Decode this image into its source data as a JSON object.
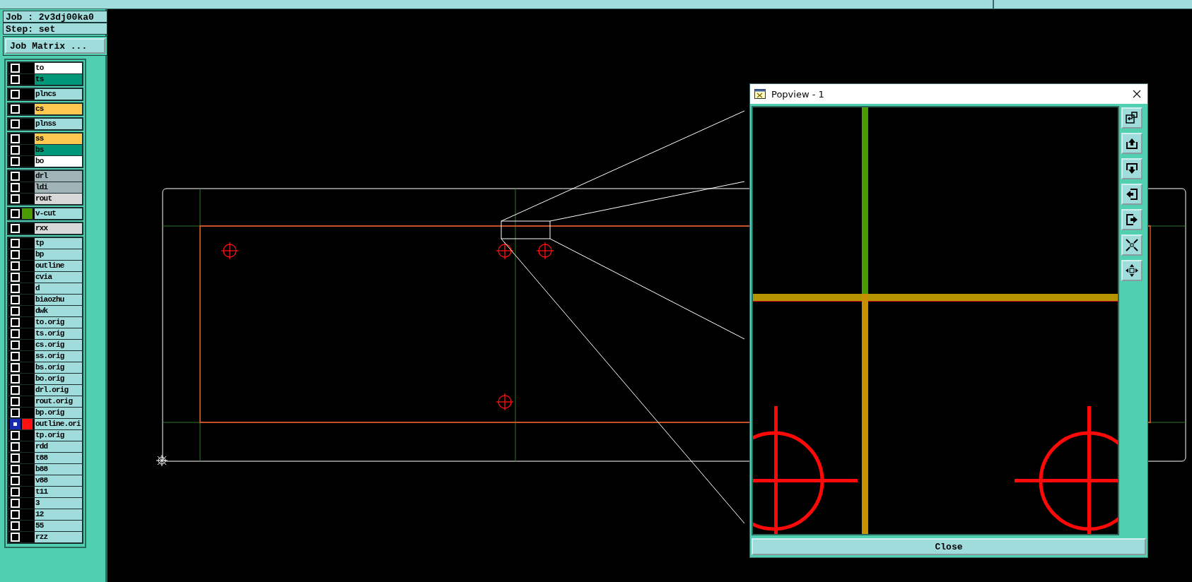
{
  "job_label": "Job : 2v3dj00ka0",
  "step_label": "Step: set",
  "job_matrix_button": "Job Matrix ...",
  "layer_groups": [
    [
      {
        "name": "to",
        "kind": "silk",
        "selected": false
      },
      {
        "name": "ts",
        "kind": "mask",
        "selected": false
      }
    ],
    [
      {
        "name": "plncs",
        "kind": "misc",
        "selected": false
      }
    ],
    [
      {
        "name": "cs",
        "kind": "signal",
        "selected": false
      }
    ],
    [
      {
        "name": "plnss",
        "kind": "misc",
        "selected": false
      }
    ],
    [
      {
        "name": "ss",
        "kind": "signal",
        "selected": false
      },
      {
        "name": "bs",
        "kind": "mask",
        "selected": false
      },
      {
        "name": "bo",
        "kind": "silk",
        "selected": false
      }
    ],
    [
      {
        "name": "drl",
        "kind": "drill",
        "selected": false
      },
      {
        "name": "ldi",
        "kind": "drill",
        "selected": false
      },
      {
        "name": "rout",
        "kind": "rout",
        "selected": false
      }
    ],
    [
      {
        "name": "v-cut",
        "kind": "misc",
        "selected": false,
        "color": "#4a9a00"
      }
    ],
    [
      {
        "name": "rxx",
        "kind": "rout",
        "selected": false
      }
    ],
    [
      {
        "name": "tp",
        "kind": "misc",
        "selected": false
      },
      {
        "name": "bp",
        "kind": "misc",
        "selected": false
      },
      {
        "name": "outline",
        "kind": "misc",
        "selected": false
      },
      {
        "name": "cvia",
        "kind": "misc",
        "selected": false
      },
      {
        "name": "d",
        "kind": "misc",
        "selected": false
      },
      {
        "name": "biaozhu",
        "kind": "misc",
        "selected": false
      },
      {
        "name": "dwk",
        "kind": "misc",
        "selected": false
      },
      {
        "name": "to.orig",
        "kind": "misc",
        "selected": false
      },
      {
        "name": "ts.orig",
        "kind": "misc",
        "selected": false
      },
      {
        "name": "cs.orig",
        "kind": "misc",
        "selected": false
      },
      {
        "name": "ss.orig",
        "kind": "misc",
        "selected": false
      },
      {
        "name": "bs.orig",
        "kind": "misc",
        "selected": false
      },
      {
        "name": "bo.orig",
        "kind": "misc",
        "selected": false
      },
      {
        "name": "drl.orig",
        "kind": "misc",
        "selected": false
      },
      {
        "name": "rout.orig",
        "kind": "misc",
        "selected": false
      },
      {
        "name": "bp.orig",
        "kind": "misc",
        "selected": false
      },
      {
        "name": "outline.ori",
        "kind": "misc",
        "selected": true,
        "color": "#ff1010"
      },
      {
        "name": "tp.orig",
        "kind": "misc",
        "selected": false
      },
      {
        "name": "rdd",
        "kind": "misc",
        "selected": false
      },
      {
        "name": "t88",
        "kind": "misc",
        "selected": false
      },
      {
        "name": "b88",
        "kind": "misc",
        "selected": false
      },
      {
        "name": "v88",
        "kind": "misc",
        "selected": false
      },
      {
        "name": "t11",
        "kind": "misc",
        "selected": false
      },
      {
        "name": "3",
        "kind": "misc",
        "selected": false
      },
      {
        "name": "12",
        "kind": "misc",
        "selected": false
      },
      {
        "name": "55",
        "kind": "misc",
        "selected": false
      },
      {
        "name": "rzz",
        "kind": "misc",
        "selected": false
      }
    ]
  ],
  "popview": {
    "title": "Popview - 1",
    "close_button": "Close"
  }
}
